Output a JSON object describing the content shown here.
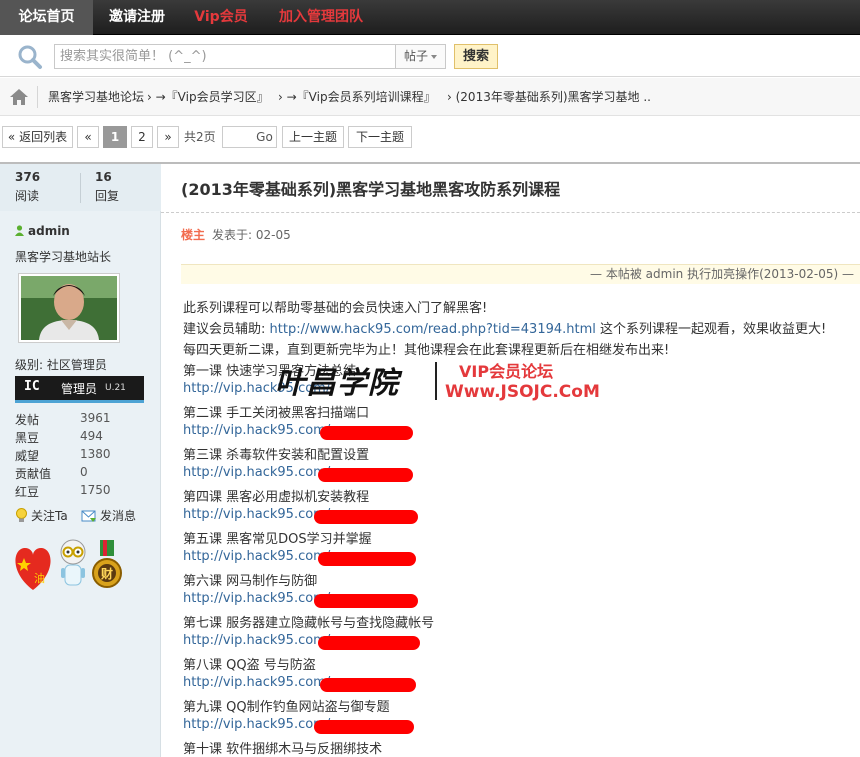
{
  "nav": [
    "论坛首页",
    "邀请注册",
    "Vip会员",
    "加入管理团队"
  ],
  "search": {
    "placeholder": "搜索其实很简单！ (^_^)",
    "type": "帖子",
    "button": "搜索"
  },
  "breadcrumb": [
    "黑客学习基地论坛",
    "› →『Vip会员学习区』",
    "› →『Vip会员系列培训课程』",
    "› (2013年零基础系列)黑客学习基地 .."
  ],
  "pager": {
    "back": "« 返回列表",
    "prev": "«",
    "pages": [
      "1",
      "2"
    ],
    "next": "»",
    "total": "共2页",
    "go": "Go",
    "prev_topic": "上一主题",
    "next_topic": "下一主题",
    "current": 1
  },
  "stats": {
    "reads": "376",
    "reads_label": "阅读",
    "replies": "16",
    "replies_label": "回复"
  },
  "user": {
    "name": "admin",
    "title": "黑客学习基地站长",
    "level": "级别: 社区管理员",
    "badge_icon": "IC",
    "badge": "管理员",
    "badge_ver": "U.21",
    "rows": [
      {
        "label": "发帖",
        "value": "3961"
      },
      {
        "label": "黑豆",
        "value": "494"
      },
      {
        "label": "威望",
        "value": "1380"
      },
      {
        "label": "贡献值",
        "value": "0"
      },
      {
        "label": "红豆",
        "value": "1750"
      }
    ],
    "actions": [
      "关注Ta",
      "发消息"
    ]
  },
  "post": {
    "title": "(2013年零基础系列)黑客学习基地黑客攻防系列课程",
    "author": "楼主",
    "time": "发表于: 02-05",
    "modnote": "— 本帖被 admin 执行加亮操作(2013-02-05) —",
    "intro1": "此系列课程可以帮助零基础的会员快速入门了解黑客!",
    "intro2_prefix": "建议会员辅助: ",
    "intro2_url": "http://www.hack95.com/read.php?tid=43194.html",
    "intro2_suffix": " 这个系列课程一起观看，效果收益更大!",
    "intro3": "每四天更新二课，直到更新完毕为止！其他课程会在此套课程更新后在相继发布出来!",
    "lessons": [
      {
        "title": "第一课 快速学习黑客方法总结",
        "url": "http://vip.hack95.com/"
      },
      {
        "title": "第二课 手工关闭被黑客扫描端口",
        "url": "http://vip.hack95.com/"
      },
      {
        "title": "第三课 杀毒软件安装和配置设置",
        "url": "http://vip.hack95.com/"
      },
      {
        "title": "第四课 黑客必用虚拟机安装教程",
        "url": "http://vip.hack95.com/"
      },
      {
        "title": "第五课 黑客常见DOS学习并掌握",
        "url": "http://vip.hack95.com/"
      },
      {
        "title": "第六课 网马制作与防御",
        "url": "http://vip.hack95.com/"
      },
      {
        "title": "第七课 服务器建立隐藏帐号与查找隐藏帐号",
        "url": "http://vip.hack95.com/"
      },
      {
        "title": "第八课 QQ盗 号与防盗",
        "url": "http://vip.hack95.com/"
      },
      {
        "title": "第九课 QQ制作钓鱼网站盗与御专题",
        "url": "http://vip.hack95.com/"
      },
      {
        "title": "第十课 软件捆绑木马与反捆绑技术",
        "url": ""
      }
    ]
  },
  "watermark": {
    "cn": "叶昌学院",
    "vip": "VIP会员论坛",
    "url": "Www.JSOJC.CoM"
  },
  "colors": {
    "accent_red": "#e4393c",
    "link": "#336699",
    "redaction": "#ff0000",
    "sidebar_bg": "#eaf1f5"
  }
}
